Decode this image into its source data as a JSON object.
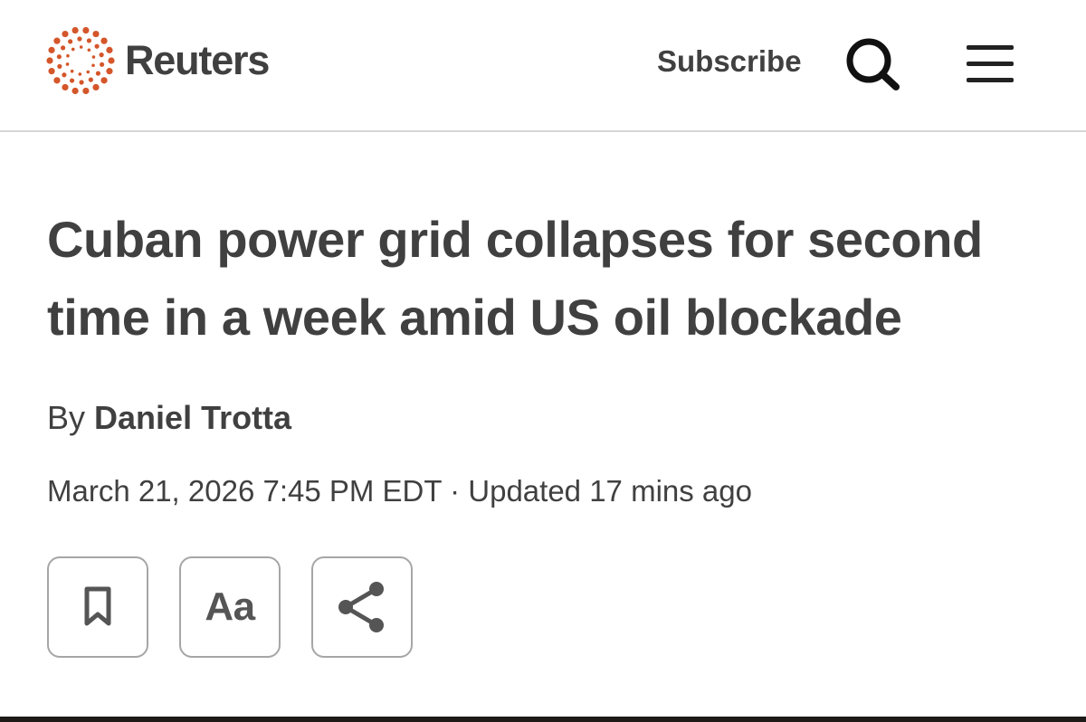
{
  "header": {
    "brand": "Reuters",
    "subscribe_label": "Subscribe",
    "search_icon": "search-icon",
    "menu_icon": "hamburger-menu-icon"
  },
  "article": {
    "headline": "Cuban power grid collapses for second time in a week amid US oil blockade",
    "byline_prefix": "By",
    "author": "Daniel Trotta",
    "dateline": "March 21, 2026 7:45 PM EDT · Updated 17 mins ago"
  },
  "actions": {
    "bookmark_icon": "bookmark-icon",
    "text_size_label": "Aa",
    "share_icon": "share-icon"
  },
  "colors": {
    "brand_orange": "#d4562a",
    "text": "#404040",
    "divider": "#d6d6d6",
    "button_border": "#a6a6a6"
  }
}
